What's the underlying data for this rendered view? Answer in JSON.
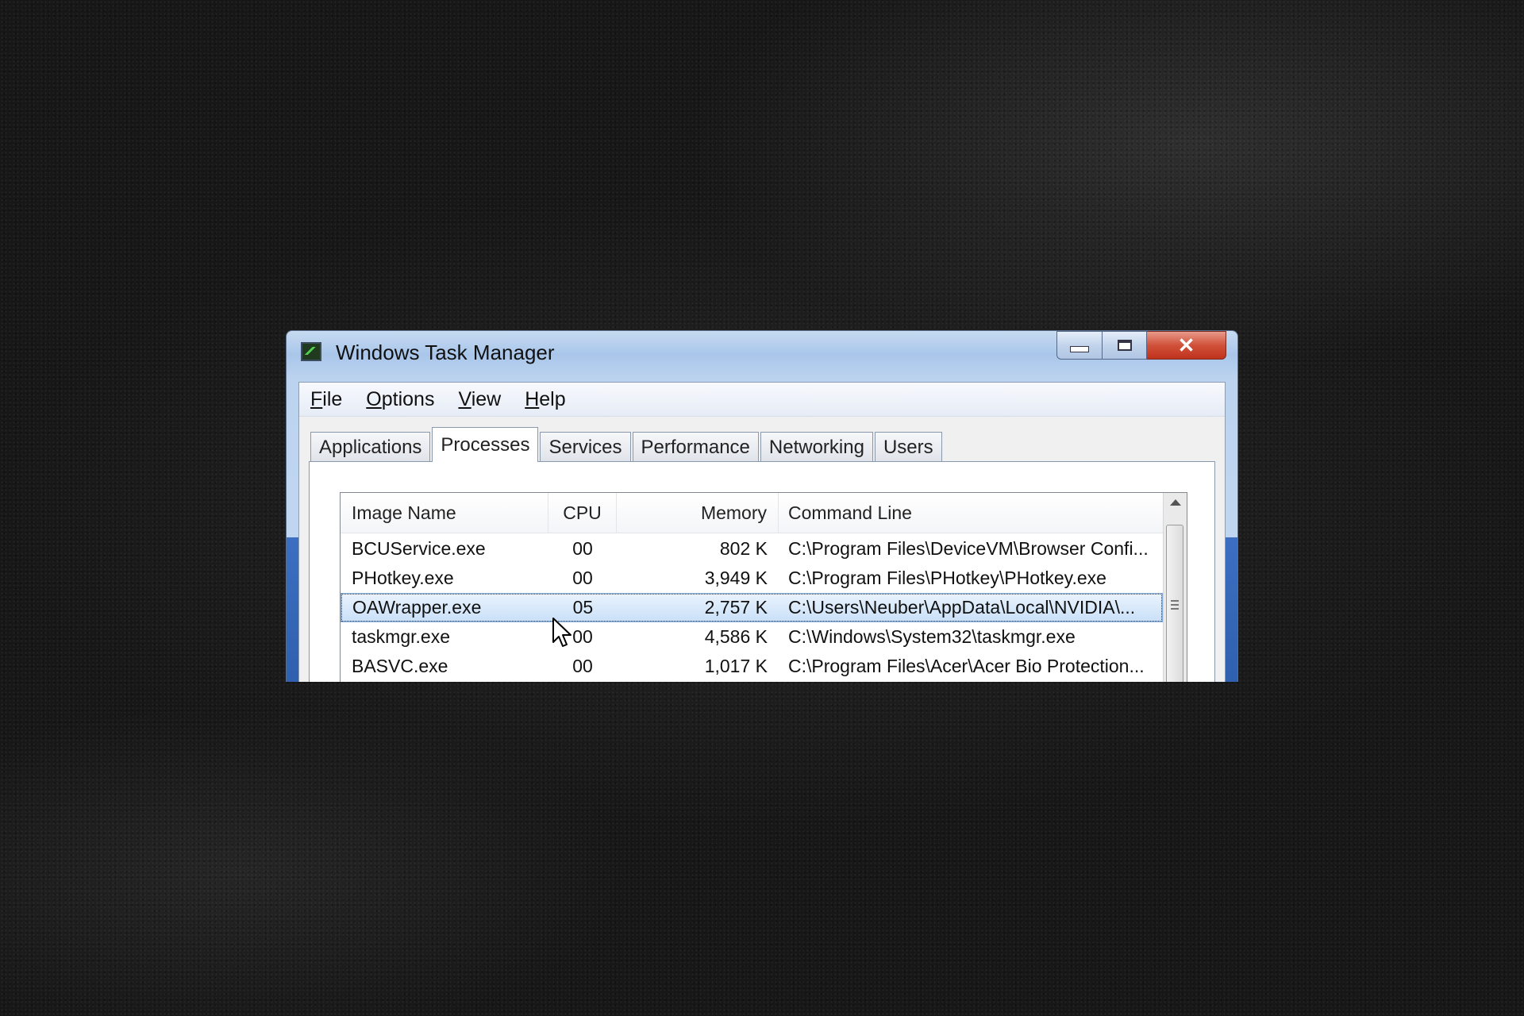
{
  "window": {
    "title": "Windows Task Manager",
    "controls": {
      "minimize": "minimize",
      "maximize": "maximize",
      "close": "✕"
    }
  },
  "menu": [
    {
      "label_u": "F",
      "label_rest": "ile"
    },
    {
      "label_u": "O",
      "label_rest": "ptions"
    },
    {
      "label_u": "V",
      "label_rest": "iew"
    },
    {
      "label_u": "H",
      "label_rest": "elp"
    }
  ],
  "tabs": [
    "Applications",
    "Processes",
    "Services",
    "Performance",
    "Networking",
    "Users"
  ],
  "active_tab": "Processes",
  "columns": {
    "image_name": "Image Name",
    "cpu": "CPU",
    "memory": "Memory",
    "command_line": "Command Line"
  },
  "processes": [
    {
      "name": "BCUService.exe",
      "cpu": "00",
      "memory": "802 K",
      "cmd": "C:\\Program Files\\DeviceVM\\Browser Confi..."
    },
    {
      "name": "PHotkey.exe",
      "cpu": "00",
      "memory": "3,949 K",
      "cmd": "C:\\Program Files\\PHotkey\\PHotkey.exe"
    },
    {
      "name": "OAWrapper.exe",
      "cpu": "05",
      "memory": "2,757 K",
      "cmd": "C:\\Users\\Neuber\\AppData\\Local\\NVIDIA\\..."
    },
    {
      "name": "taskmgr.exe",
      "cpu": "00",
      "memory": "4,586 K",
      "cmd": "C:\\Windows\\System32\\taskmgr.exe"
    },
    {
      "name": "BASVC.exe",
      "cpu": "00",
      "memory": "1,017 K",
      "cmd": "C:\\Program Files\\Acer\\Acer Bio Protection..."
    }
  ],
  "selected_process": "OAWrapper.exe",
  "colors": {
    "selection": "#c9e0f8",
    "close_button": "#c0321c",
    "titlebar": "#a9c6ea"
  }
}
